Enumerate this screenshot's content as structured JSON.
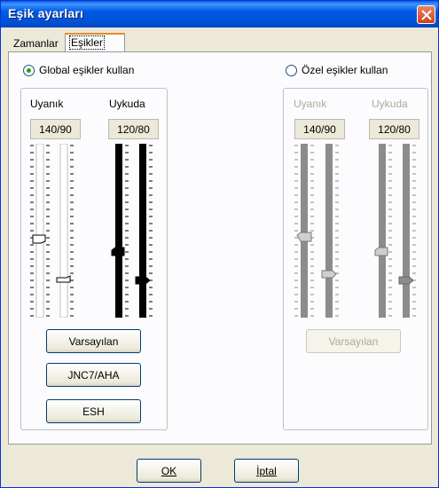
{
  "window": {
    "title": "Eşik ayarları"
  },
  "tabs": [
    {
      "label": "Zamanlar"
    },
    {
      "label": "Eşikler"
    }
  ],
  "global": {
    "radio_label": "Global eşikler kullan",
    "selected": true,
    "awake_label": "Uyanık",
    "sleep_label": "Uykuda",
    "awake_value": "140/90",
    "sleep_value": "120/80",
    "buttons": {
      "default": "Varsayılan",
      "jnc": "JNC7/AHA",
      "esh": "ESH"
    }
  },
  "custom": {
    "radio_label": "Özel eşikler kullan",
    "selected": false,
    "awake_label": "Uyanık",
    "sleep_label": "Uykuda",
    "awake_value": "140/90",
    "sleep_value": "120/80",
    "buttons": {
      "default": "Varsayılan"
    }
  },
  "footer": {
    "ok_label": "OK",
    "cancel_label": "İptal"
  }
}
